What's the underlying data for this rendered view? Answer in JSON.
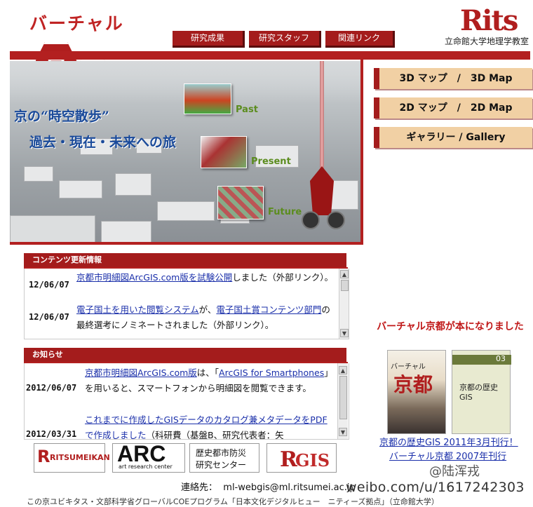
{
  "logo": {
    "title": "バーチャル",
    "kanji1": "京",
    "kanji2": "都"
  },
  "brand": {
    "name": "Rits",
    "subtitle": "立命館大学地理学教室"
  },
  "nav": [
    "研究成果",
    "研究スタッフ",
    "関連リンク"
  ],
  "hero": {
    "labels": [
      "Past",
      "Present",
      "Future"
    ],
    "line1": "京の“時空散歩”",
    "line2": "過去・現在・未来への旅"
  },
  "menu": [
    "3D マップ　/　3D Map",
    "2D マップ　/　2D Map",
    "ギャラリー / Gallery"
  ],
  "updates": {
    "header": "コンテンツ更新情報",
    "items": [
      {
        "date": "12/06/07",
        "link": "京都市明細図ArcGIS.com版を試験公開",
        "rest": "しました（外部リンク）。"
      },
      {
        "date": "12/06/07",
        "link1": "電子国土を用いた閲覧システム",
        "mid": "が、",
        "link2": "電子国土賞コンテンツ部門",
        "rest": "の最終選考にノミネートされました（外部リンク）。"
      }
    ]
  },
  "notices": {
    "header": "お知らせ",
    "items": [
      {
        "date": "2012/06/07",
        "link1": "京都市明細図ArcGIS.com版",
        "mid": "は、「",
        "link2": "ArcGIS for Smartphones",
        "rest": "」を用いると、スマートフォンから明細図を閲覧できます。"
      },
      {
        "date": "2012/03/31",
        "link1": "これまでに作成したGISデータのカタログ兼メタデータをPDFで作成しました",
        "rest": "（科研費（基盤B、研究代表者：矢"
      }
    ]
  },
  "footer_logos": [
    "RITSUMEIKAN",
    "ARC",
    "art research center",
    "歴史都市防災",
    "研究センター"
  ],
  "contact": {
    "label": "連絡先：",
    "email": "ml-webgis@ml.ritsumei.ac.jp"
  },
  "bottom_text": "この京ユビキタス・文部科学省グローバルCOEプログラム「日本文化デジタルヒュー　ニティーズ拠点」（立命館大学）",
  "book": {
    "heading": "バーチャル京都が本になりました",
    "cover1_small": "バーチャル",
    "cover1_big": "京都",
    "cover2_title": "京都の歴史GIS",
    "cover2_num": "03",
    "link1": "京都の歴史GIS 2011年3月刊行！",
    "link2": "バーチャル京都 2007年刊行"
  },
  "watermark": {
    "handle": "@陆浑戎",
    "url": "weibo.com/u/1617242303"
  },
  "colors": {
    "accent": "#a41c1c",
    "menu_bg": "#f1d0a4",
    "link": "#1a2faa",
    "hero_text": "#1a4a9a"
  }
}
